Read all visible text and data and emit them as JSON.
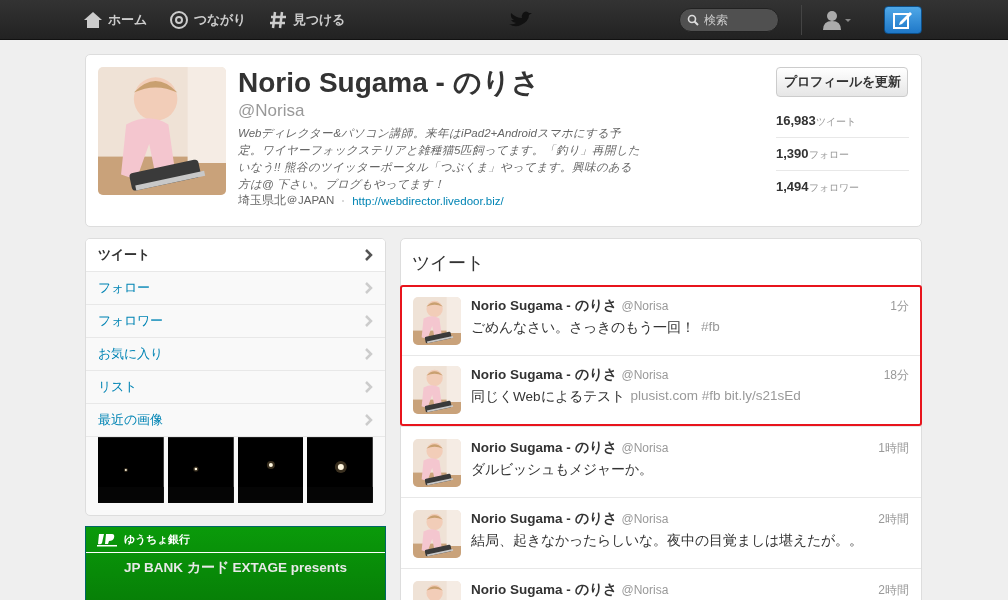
{
  "topbar": {
    "nav": [
      {
        "label": "ホーム",
        "kind": "home"
      },
      {
        "label": "つながり",
        "kind": "at"
      },
      {
        "label": "見つける",
        "kind": "hash"
      }
    ],
    "search": {
      "placeholder": "検索"
    }
  },
  "profile": {
    "name": "Norio Sugama - のりさ",
    "handle": "@Norisa",
    "bio": "Webディレクター&パソコン講師。来年はiPad2+Androidスマホにする予定。ワイヤーフォックステリアと雑種猫5匹飼ってます。「釣り」再開したいなう!! 熊谷のツイッターポータル「つぶくま」やってます。興味のある方は@ 下さい。ブログもやってます！",
    "location": "埼玉県北＠JAPAN",
    "url": "http://webdirector.livedoor.biz/",
    "edit_button": "プロフィールを更新",
    "stats": [
      {
        "value": "16,983",
        "label": "ツイート"
      },
      {
        "value": "1,390",
        "label": "フォロー"
      },
      {
        "value": "1,494",
        "label": "フォロワー"
      }
    ]
  },
  "sidebar": {
    "items": [
      {
        "label": "ツイート",
        "selected": true
      },
      {
        "label": "フォロー",
        "selected": false
      },
      {
        "label": "フォロワー",
        "selected": false
      },
      {
        "label": "お気に入り",
        "selected": false
      },
      {
        "label": "リスト",
        "selected": false
      },
      {
        "label": "最近の画像",
        "selected": false
      }
    ]
  },
  "ad": {
    "bank": "ゆうちょ銀行",
    "headline": "JP BANK カード EXTAGE presents"
  },
  "timeline": {
    "title": "ツイート",
    "tweets": [
      {
        "name": "Norio Sugama - のりさ",
        "handle": "@Norisa",
        "time": "1分",
        "text": "ごめんなさい。さっきのもう一回！",
        "extra": "#fb",
        "highlighted": true
      },
      {
        "name": "Norio Sugama - のりさ",
        "handle": "@Norisa",
        "time": "18分",
        "text": "同じくWebによるテスト",
        "extra": "plusist.com #fb bit.ly/s21sEd",
        "highlighted": true
      },
      {
        "name": "Norio Sugama - のりさ",
        "handle": "@Norisa",
        "time": "1時間",
        "text": "ダルビッシュもメジャーか。",
        "highlighted": false
      },
      {
        "name": "Norio Sugama - のりさ",
        "handle": "@Norisa",
        "time": "2時間",
        "text": "結局、起きなかったらしいな。夜中の目覚ましは堪えたが。。",
        "highlighted": false
      },
      {
        "name": "Norio Sugama - のりさ",
        "handle": "@Norisa",
        "time": "2時間",
        "highlighted": false
      }
    ]
  }
}
